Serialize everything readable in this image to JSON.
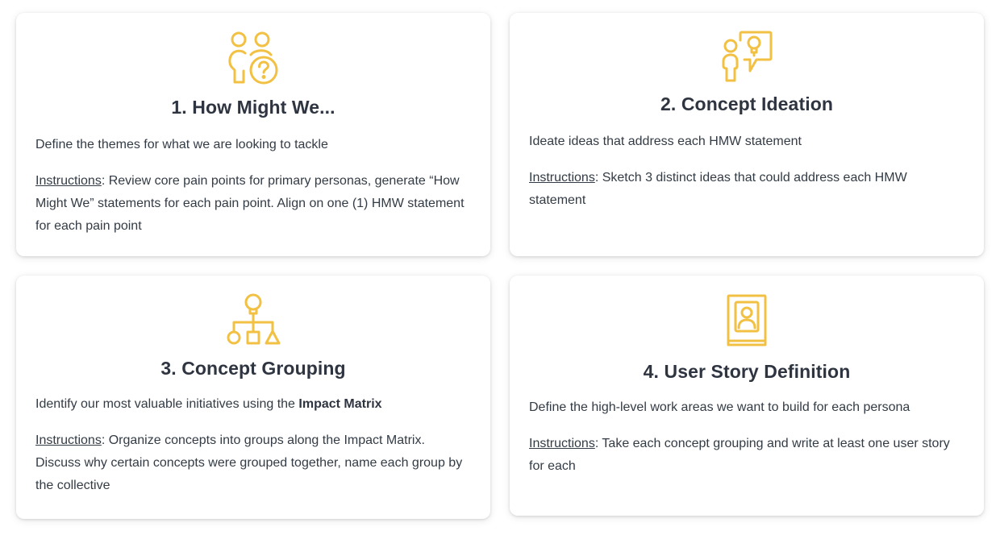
{
  "accent_color": "#f2c144",
  "cards": [
    {
      "icon": "people-question-icon",
      "title": "1. How Might We...",
      "description": "Define the themes for what we are looking to tackle",
      "instructions_label": "Instructions",
      "instructions_text": ": Review core pain points for primary personas, generate “How Might We” statements for each pain point. Align on one (1) HMW statement for each pain point"
    },
    {
      "icon": "person-idea-bubble-icon",
      "title": "2. Concept Ideation",
      "description": "Ideate ideas that address each HMW statement",
      "instructions_label": "Instructions",
      "instructions_text": ": Sketch 3 distinct ideas that could address each HMW statement"
    },
    {
      "icon": "hierarchy-shapes-icon",
      "title": "3. Concept Grouping",
      "description_prefix": "Identify our most valuable initiatives using the ",
      "description_emphasis": "Impact Matrix",
      "instructions_label": "Instructions",
      "instructions_text": ": Organize concepts into groups along the Impact Matrix. Discuss why certain concepts were grouped together, name each group by the collective"
    },
    {
      "icon": "user-book-icon",
      "title": "4. User Story Definition",
      "description": "Define the high-level work areas we want to build for each persona",
      "instructions_label": "Instructions",
      "instructions_text": ": Take each concept grouping and write at least one user story for each"
    }
  ]
}
